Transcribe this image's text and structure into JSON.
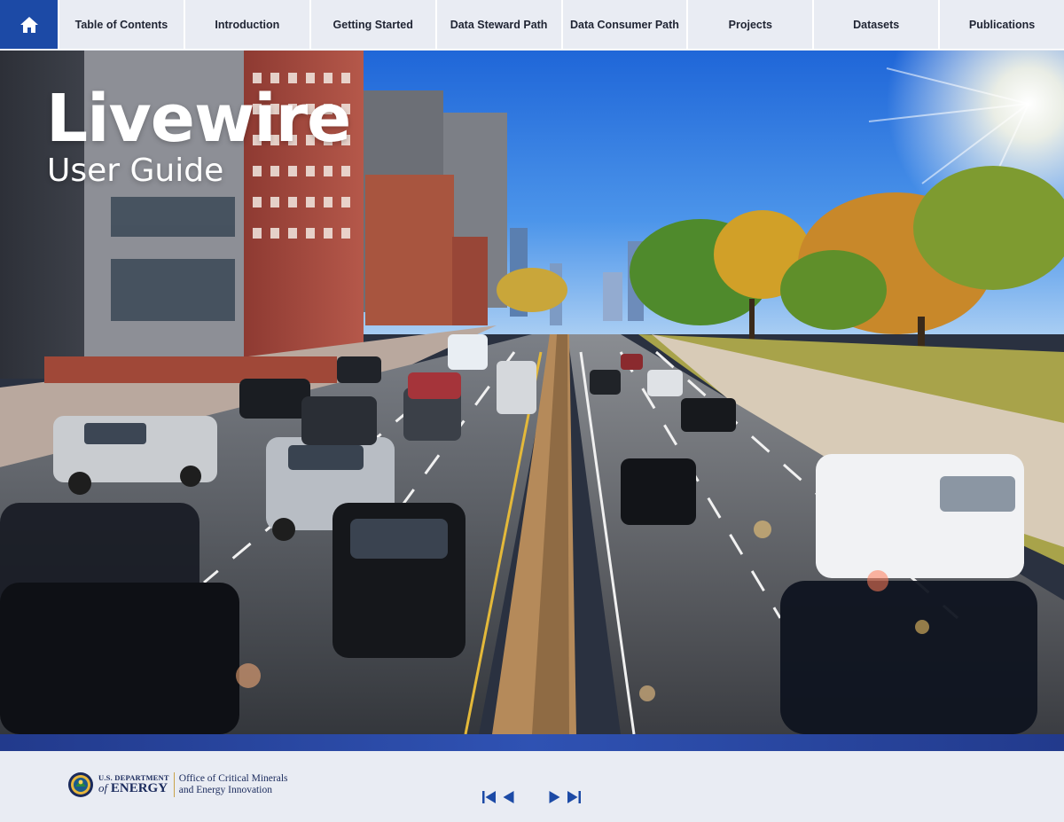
{
  "nav": {
    "home_icon": "home-icon",
    "items": [
      {
        "label": "Table of Contents"
      },
      {
        "label": "Introduction"
      },
      {
        "label": "Getting Started"
      },
      {
        "label": "Data Steward Path"
      },
      {
        "label": "Data Consumer Path"
      },
      {
        "label": "Projects"
      },
      {
        "label": "Datasets"
      },
      {
        "label": "Publications"
      }
    ]
  },
  "hero": {
    "title": "Livewire",
    "subtitle": "User Guide"
  },
  "footer": {
    "doe_line1": "U.S. DEPARTMENT",
    "doe_of": "of",
    "doe_line2": "ENERGY",
    "office_line1": "Office of Critical Minerals",
    "office_line2": "and Energy Innovation",
    "pager_icons": [
      "first-page-icon",
      "previous-page-icon",
      "next-page-icon",
      "last-page-icon"
    ]
  },
  "colors": {
    "accent": "#1c4aa6",
    "band": "#2a47a3",
    "nav_bg": "#e9ecf3",
    "text_dark": "#1f2433"
  }
}
